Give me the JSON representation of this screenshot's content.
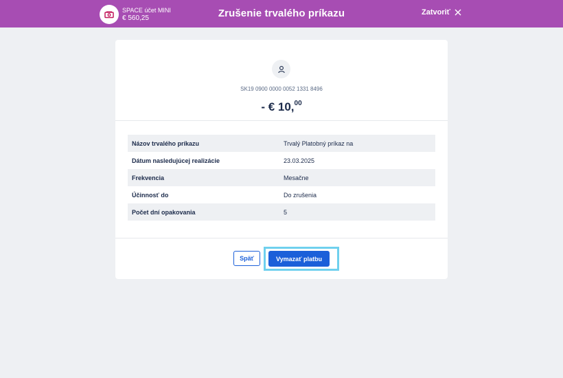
{
  "header": {
    "account_name": "SPACE účet MINI",
    "account_balance": "€ 560,25",
    "account_icon": "banknote-icon",
    "title": "Zrušenie trvalého príkazu",
    "close_label": "Zatvoriť",
    "close_icon": "close-icon",
    "bar_color": "#a74db3"
  },
  "recipient": {
    "icon": "user-icon",
    "iban": "SK19 0900 0000 0052 1331 8496"
  },
  "amount": {
    "main": "- € 10,",
    "cents": "00"
  },
  "details": [
    {
      "label": "Názov trvalého príkazu",
      "value": "Trvalý Platobný príkaz na"
    },
    {
      "label": "Dátum nasledujúcej realizácie",
      "value": "23.03.2025"
    },
    {
      "label": "Frekvencia",
      "value": "Mesačne"
    },
    {
      "label": "Účinnosť do",
      "value": "Do zrušenia"
    },
    {
      "label": "Počet dní opakovania",
      "value": "5"
    }
  ],
  "actions": {
    "back_label": "Späť",
    "delete_label": "Vymazať platbu",
    "primary_color": "#1b5fd9",
    "focus_color": "#6fd0ee"
  }
}
